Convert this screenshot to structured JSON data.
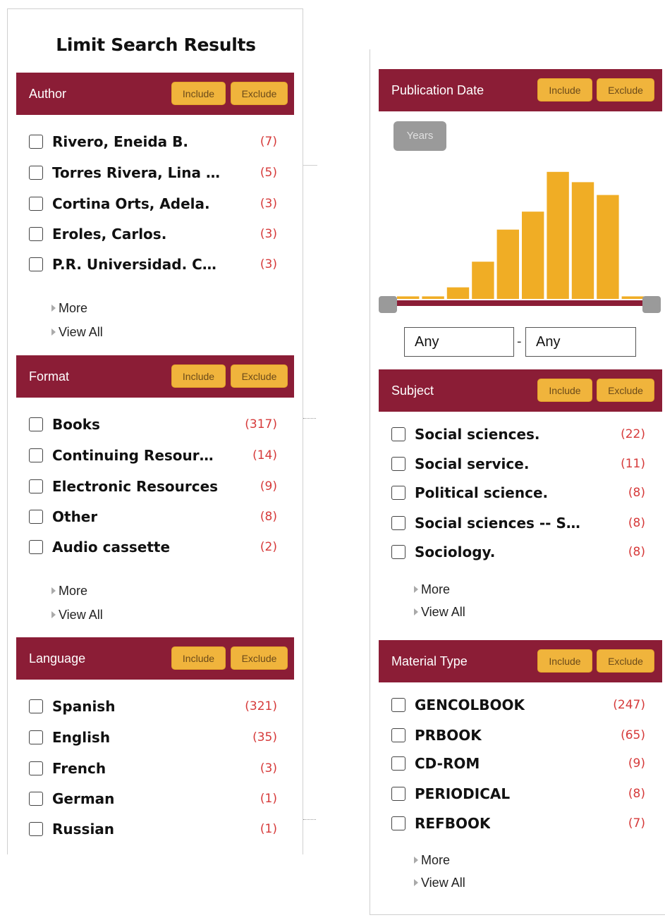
{
  "left": {
    "title": "Limit Search Results",
    "facets": [
      {
        "title": "Author",
        "include": "Include",
        "exclude": "Exclude",
        "items": [
          {
            "label": "Rivero, Eneida B.",
            "count": "(7)"
          },
          {
            "label": "Torres Rivera, Lina …",
            "count": "(5)"
          },
          {
            "label": "Cortina Orts, Adela.",
            "count": "(3)"
          },
          {
            "label": "Eroles, Carlos.",
            "count": "(3)"
          },
          {
            "label": "P.R. Universidad. C…",
            "count": "(3)"
          }
        ],
        "more": "More",
        "view_all": "View All"
      },
      {
        "title": "Format",
        "include": "Include",
        "exclude": "Exclude",
        "items": [
          {
            "label": "Books",
            "count": "(317)"
          },
          {
            "label": "Continuing Resour…",
            "count": "(14)"
          },
          {
            "label": "Electronic Resources",
            "count": "(9)"
          },
          {
            "label": "Other",
            "count": "(8)"
          },
          {
            "label": "Audio cassette",
            "count": "(2)"
          }
        ],
        "more": "More",
        "view_all": "View All"
      },
      {
        "title": "Language",
        "include": "Include",
        "exclude": "Exclude",
        "items": [
          {
            "label": "Spanish",
            "count": "(321)"
          },
          {
            "label": "English",
            "count": "(35)"
          },
          {
            "label": "French",
            "count": "(3)"
          },
          {
            "label": "German",
            "count": "(1)"
          },
          {
            "label": "Russian",
            "count": "(1)"
          }
        ]
      }
    ]
  },
  "right": {
    "pubdate": {
      "title": "Publication Date",
      "include": "Include",
      "exclude": "Exclude",
      "years_button": "Years",
      "from_value": "Any",
      "to_value": "Any",
      "separator": "-",
      "histogram": {
        "bar_color": "#f0ad25",
        "track_color": "#8b1d36",
        "relative_heights": [
          0.02,
          0.02,
          0.09,
          0.29,
          0.54,
          0.68,
          0.99,
          0.91,
          0.81,
          0.02
        ]
      }
    },
    "facets": [
      {
        "title": "Subject",
        "include": "Include",
        "exclude": "Exclude",
        "items": [
          {
            "label": "Social sciences.",
            "count": "(22)"
          },
          {
            "label": "Social service.",
            "count": "(11)"
          },
          {
            "label": "Political science.",
            "count": "(8)"
          },
          {
            "label": "Social sciences -- S…",
            "count": "(8)"
          },
          {
            "label": "Sociology.",
            "count": "(8)"
          }
        ],
        "more": "More",
        "view_all": "View All"
      },
      {
        "title": "Material Type",
        "include": "Include",
        "exclude": "Exclude",
        "items": [
          {
            "label": "GENCOLBOOK",
            "count": "(247)"
          },
          {
            "label": "PRBOOK",
            "count": "(65)"
          },
          {
            "label": "CD-ROM",
            "count": "(9)"
          },
          {
            "label": "PERIODICAL",
            "count": "(8)"
          },
          {
            "label": "REFBOOK",
            "count": "(7)"
          }
        ],
        "more": "More",
        "view_all": "View All"
      }
    ]
  },
  "colors": {
    "header_bg": "#8b1d36",
    "button_bg": "#f0b43c",
    "count_color": "#d63a3a"
  }
}
